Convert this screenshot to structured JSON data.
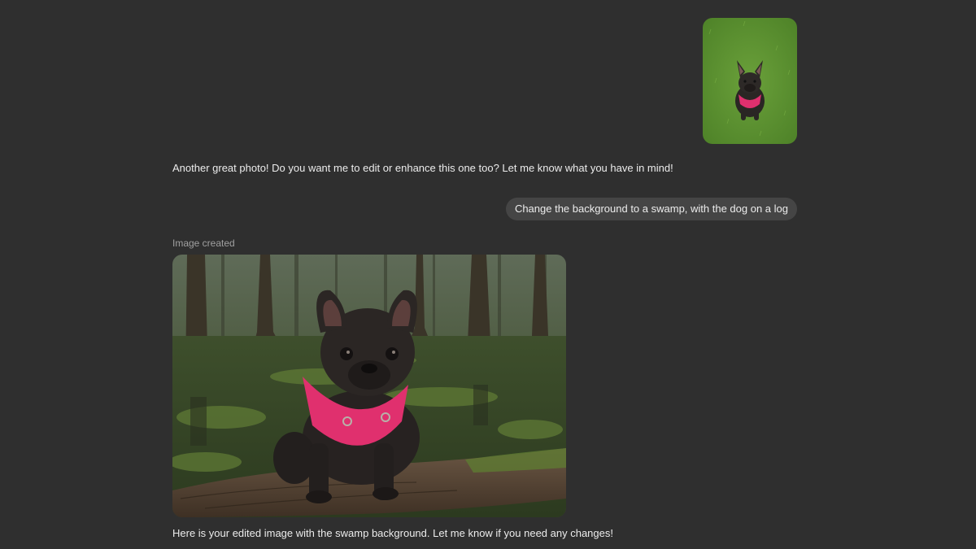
{
  "conversation": {
    "assistant_reply_1": "Another great photo! Do you want me to edit or enhance this one too? Let me know what you have in mind!",
    "user_message": "Change the background to a swamp, with the dog on a log",
    "image_created_label": "Image created",
    "assistant_reply_2": "Here is your edited image with the swamp background. Let me know if you need any changes!"
  },
  "colors": {
    "background": "#2f2f2f",
    "user_bubble": "#454545",
    "text": "#ececec",
    "muted_text": "#a0a0a0",
    "harness_pink": "#e0306e"
  }
}
